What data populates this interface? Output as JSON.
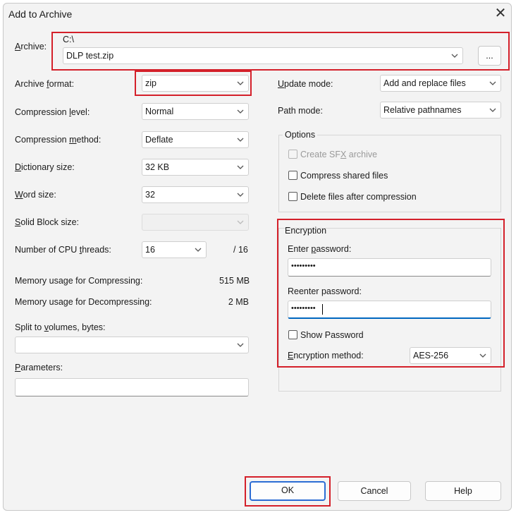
{
  "window": {
    "title": "Add to Archive",
    "close_glyph": "✕"
  },
  "archive": {
    "label": "Archive:",
    "path": "C:\\",
    "filename": "DLP test.zip",
    "browse_label": "..."
  },
  "left": {
    "format": {
      "label": "Archive format:",
      "value": "zip"
    },
    "level": {
      "label": "Compression level:",
      "value": "Normal"
    },
    "method": {
      "label": "Compression method:",
      "value": "Deflate"
    },
    "dictionary": {
      "label": "Dictionary size:",
      "value": "32 KB"
    },
    "word": {
      "label": "Word size:",
      "value": "32"
    },
    "solid": {
      "label": "Solid Block size:",
      "value": ""
    },
    "threads": {
      "label": "Number of CPU threads:",
      "value": "16",
      "max": "/ 16"
    },
    "mem_compress": {
      "label": "Memory usage for Compressing:",
      "value": "515 MB"
    },
    "mem_decompress": {
      "label": "Memory usage for Decompressing:",
      "value": "2 MB"
    },
    "split": {
      "label": "Split to volumes, bytes:",
      "value": ""
    },
    "parameters": {
      "label": "Parameters:",
      "value": ""
    }
  },
  "right": {
    "update_mode": {
      "label": "Update mode:",
      "value": "Add and replace files"
    },
    "path_mode": {
      "label": "Path mode:",
      "value": "Relative pathnames"
    },
    "options": {
      "title": "Options",
      "sfx": "Create SFX archive",
      "shared": "Compress shared files",
      "delete": "Delete files after compression"
    },
    "encryption": {
      "title": "Encryption",
      "enter_label": "Enter password:",
      "enter_value": "•••••••••",
      "reenter_label": "Reenter password:",
      "reenter_value": "•••••••••",
      "show_password": "Show Password",
      "method_label": "Encryption method:",
      "method_value": "AES-256"
    }
  },
  "buttons": {
    "ok": "OK",
    "cancel": "Cancel",
    "help": "Help"
  },
  "colors": {
    "highlight": "#d4202a",
    "focus": "#2b6cd4",
    "input_focus_line": "#0067c0"
  }
}
